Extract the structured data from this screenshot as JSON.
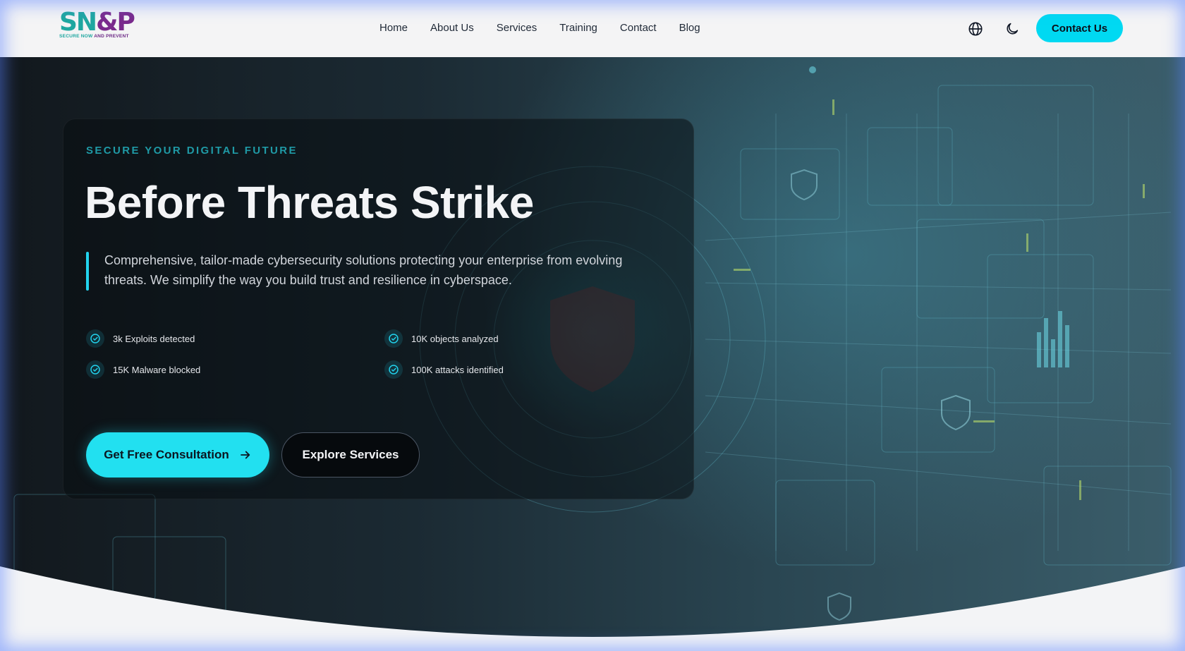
{
  "header": {
    "logo": {
      "primary_part1": "SN",
      "primary_part2": "&P",
      "tagline_part1": "SECURE NOW ",
      "tagline_part2": "AND PREVENT"
    },
    "nav": [
      "Home",
      "About Us",
      "Services",
      "Training",
      "Contact",
      "Blog"
    ],
    "icons": {
      "language": "globe-icon",
      "theme": "moon-icon"
    },
    "contact_button": "Contact Us"
  },
  "hero": {
    "eyebrow": "SECURE YOUR DIGITAL FUTURE",
    "title": "Before Threats Strike",
    "lead": "Comprehensive, tailor-made cybersecurity solutions protecting your enterprise from evolving threats. We simplify the way you build trust and resilience in cyberspace.",
    "stats": [
      "3k Exploits detected",
      "10K objects analyzed",
      "15K Malware blocked",
      "100K attacks identified"
    ],
    "primary_button": "Get Free Consultation",
    "secondary_button": "Explore Services"
  },
  "colors": {
    "accent": "#22d3ee",
    "contact_button": "#00d9f2",
    "eyebrow": "#1f9aa6",
    "logo_teal": "#1fa7a0",
    "logo_purple": "#7a2a8c"
  }
}
